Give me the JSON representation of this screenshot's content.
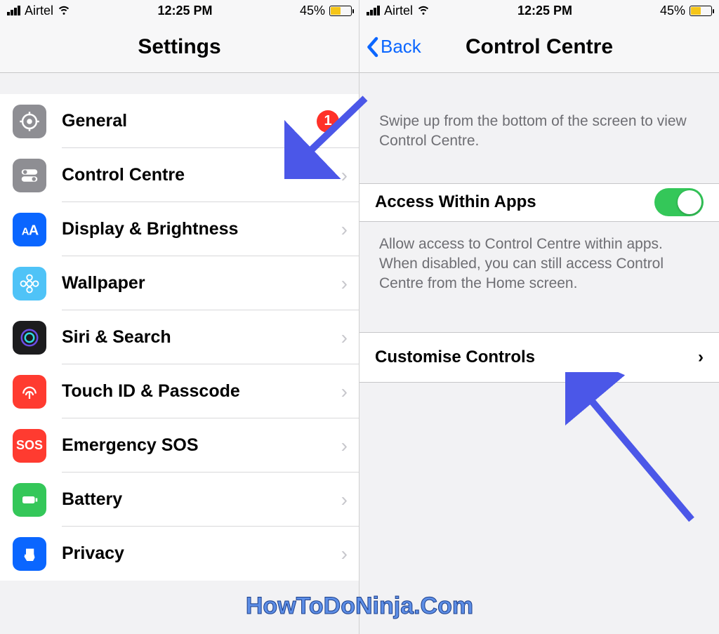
{
  "status": {
    "carrier": "Airtel",
    "time": "12:25 PM",
    "battery_pct": "45%"
  },
  "left": {
    "title": "Settings",
    "items": [
      {
        "label": "General",
        "badge": "1"
      },
      {
        "label": "Control Centre"
      },
      {
        "label": "Display & Brightness"
      },
      {
        "label": "Wallpaper"
      },
      {
        "label": "Siri & Search"
      },
      {
        "label": "Touch ID & Passcode"
      },
      {
        "label": "Emergency SOS"
      },
      {
        "label": "Battery"
      },
      {
        "label": "Privacy"
      }
    ]
  },
  "right": {
    "back": "Back",
    "title": "Control Centre",
    "swipe_desc": "Swipe up from the bottom of the screen to view Control Centre.",
    "access_label": "Access Within Apps",
    "access_desc": "Allow access to Control Centre within apps. When disabled, you can still access Control Centre from the Home screen.",
    "customise": "Customise Controls"
  },
  "watermark": "HowToDoNinja.Com"
}
